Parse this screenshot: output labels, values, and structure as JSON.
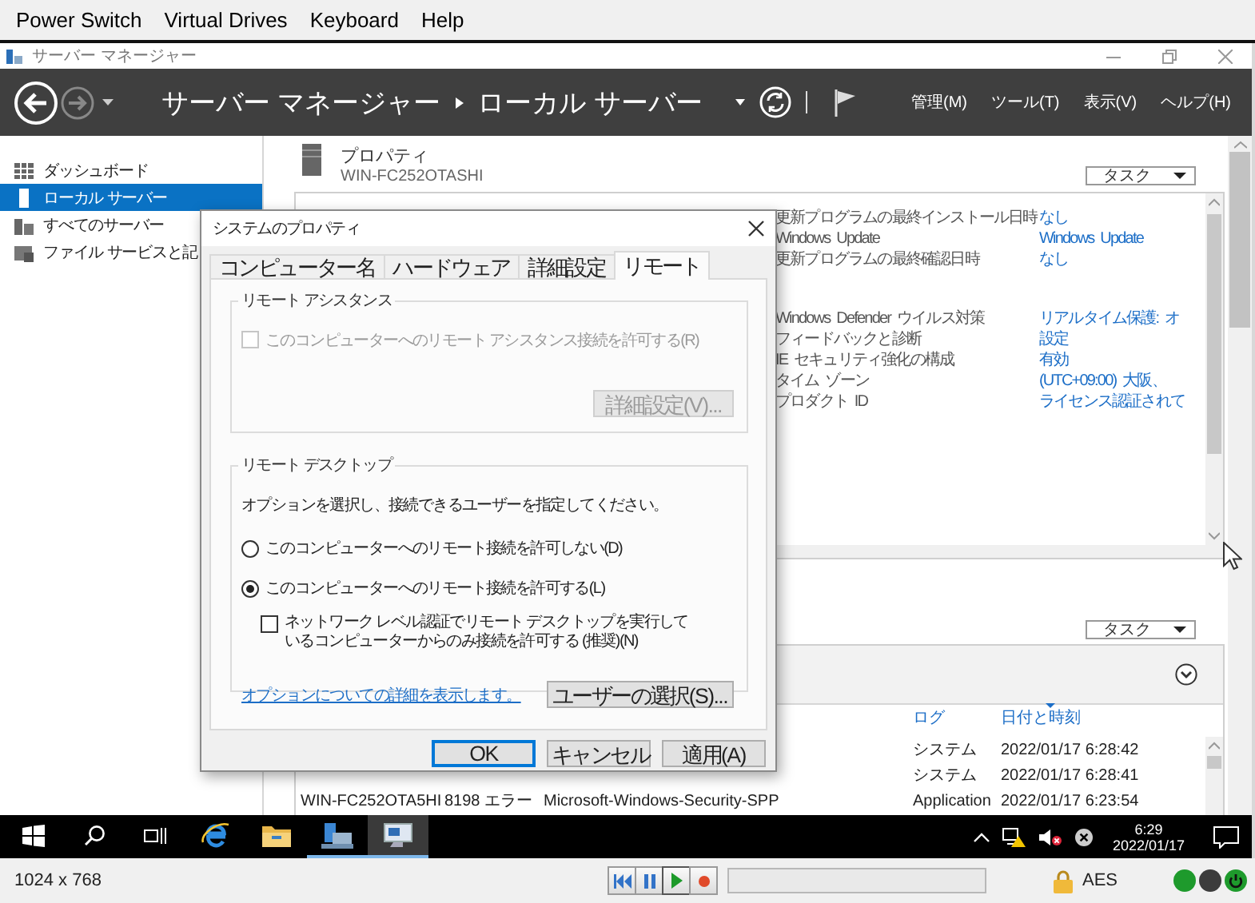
{
  "host_menu": [
    "Power Switch",
    "Virtual Drives",
    "Keyboard",
    "Help"
  ],
  "window": {
    "title": "サーバー マネージャー"
  },
  "header": {
    "breadcrumb": [
      "サーバー マネージャー",
      "ローカル サーバー"
    ],
    "menus": [
      "管理(M)",
      "ツール(T)",
      "表示(V)",
      "ヘルプ(H)"
    ]
  },
  "sidebar": {
    "items": [
      {
        "label": "ダッシュボード",
        "kind": "dashboard",
        "selected": false
      },
      {
        "label": "ローカル サーバー",
        "kind": "server",
        "selected": true
      },
      {
        "label": "すべてのサーバー",
        "kind": "servers",
        "selected": false
      },
      {
        "label": "ファイル サービスと記",
        "kind": "files",
        "selected": false
      }
    ]
  },
  "properties": {
    "title": "プロパティ",
    "server": "WIN-FC252OTASHI",
    "tasks_button": "タスク",
    "row_groups": [
      [
        {
          "label": "更新プログラムの最終インストール日時",
          "value": "なし"
        },
        {
          "label": "Windows Update",
          "value": "Windows Update"
        },
        {
          "label": "更新プログラムの最終確認日時",
          "value": "なし"
        }
      ],
      [
        {
          "label": "Windows Defender ウイルス対策",
          "value": "リアルタイム保護: オ"
        },
        {
          "label": "フィードバックと診断",
          "value": "設定"
        },
        {
          "label": "IE セキュリティ強化の構成",
          "value": "有効"
        },
        {
          "label": "タイム ゾーン",
          "value": "(UTC+09:00) 大阪、"
        },
        {
          "label": "プロダクト ID",
          "value": "ライセンス認証されて"
        }
      ]
    ]
  },
  "events": {
    "tasks_button": "タスク",
    "columns": [
      {
        "label": "ログ",
        "sorted": false
      },
      {
        "label": "日付と時刻",
        "sorted": true
      }
    ],
    "rows": [
      {
        "log": "システム",
        "date_time": "2022/01/17 6:28:42"
      },
      {
        "log": "システム",
        "date_time": "2022/01/17 6:28:41"
      },
      {
        "server": "WIN-FC252OTA5HI",
        "event_id": "8198",
        "severity": "エラー",
        "source": "Microsoft-Windows-Security-SPP",
        "log": "Application",
        "date_time": "2022/01/17 6:23:54"
      }
    ]
  },
  "dialog": {
    "title": "システムのプロパティ",
    "tabs": [
      {
        "label": "コンピューター名",
        "selected": false
      },
      {
        "label": "ハードウェア",
        "selected": false
      },
      {
        "label": "詳細設定",
        "selected": false
      },
      {
        "label": "リモート",
        "selected": true
      }
    ],
    "remote_assistance": {
      "title": "リモート アシスタンス",
      "checkbox": {
        "label": "このコンピューターへのリモート アシスタンス接続を許可する(R)",
        "checked": false,
        "disabled": true
      },
      "button": {
        "label": "詳細設定(V)...",
        "disabled": true
      }
    },
    "remote_desktop": {
      "title": "リモート デスクトップ",
      "description": "オプションを選択し、接続できるユーザーを指定してください。",
      "options": [
        {
          "label": "このコンピューターへのリモート接続を許可しない(D)",
          "selected": false
        },
        {
          "label": "このコンピューターへのリモート接続を許可する(L)",
          "selected": true
        }
      ],
      "nla_checkbox": {
        "label": "ネットワーク レベル認証でリモート デスクトップを実行しているコンピューターからのみ接続を許可する (推奨)(N)",
        "checked": false,
        "disabled": false
      },
      "link": "オプションについての詳細を表示します。",
      "button": "ユーザーの選択(S)..."
    },
    "buttons": [
      {
        "label": "OK",
        "default": true
      },
      {
        "label": "キャンセル",
        "default": false
      },
      {
        "label": "適用(A)",
        "default": false
      }
    ]
  },
  "taskbar": {
    "apps": [
      {
        "kind": "start",
        "running": false,
        "selected": false
      },
      {
        "kind": "search",
        "running": false,
        "selected": false
      },
      {
        "kind": "task-view",
        "running": false,
        "selected": false
      },
      {
        "kind": "browser",
        "running": false,
        "selected": false
      },
      {
        "kind": "folder",
        "running": false,
        "selected": false
      },
      {
        "kind": "server-manager",
        "running": true,
        "selected": false
      },
      {
        "kind": "remote-app",
        "running": true,
        "selected": true
      }
    ],
    "time": "6:29",
    "date": "2022/01/17"
  },
  "statusbar": {
    "resolution": "1024 x 768",
    "progress": {
      "level": 0
    },
    "encryption": "AES",
    "indicators": [
      {
        "kind": "dot",
        "color": "#1e9a2c"
      },
      {
        "kind": "dot",
        "color": "#3c3c3c"
      },
      {
        "kind": "power",
        "color": "#1e9a2c"
      }
    ]
  }
}
